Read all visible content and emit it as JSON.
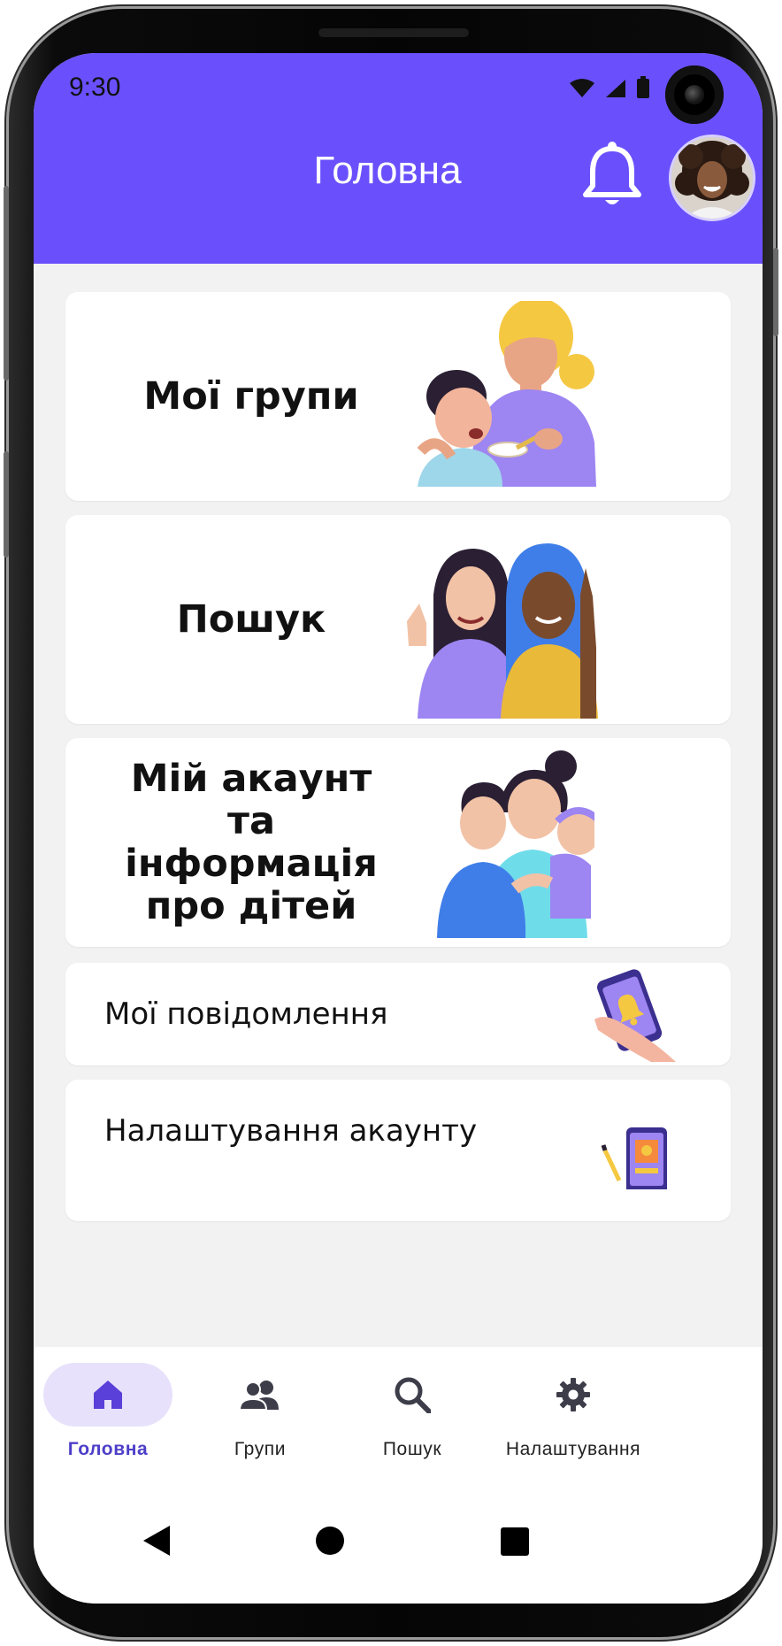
{
  "status_bar": {
    "time": "9:30"
  },
  "header": {
    "title": "Головна"
  },
  "colors": {
    "accent": "#6a50fc",
    "active_nav_bg": "#e8e1fb",
    "active_nav_text": "#4d3fc8"
  },
  "cards": [
    {
      "title": "Мої групи",
      "illustration": "mother-feeding-child-illustration"
    },
    {
      "title": "Пошук",
      "illustration": "two-women-thumbs-up-illustration"
    },
    {
      "title": "Мій акаунт та інформація про дітей",
      "illustration": "family-with-children-illustration"
    },
    {
      "title": "Мої повідомлення",
      "illustration": "phone-notification-illustration"
    },
    {
      "title": "Налаштування акаунту",
      "illustration": "phone-profile-illustration"
    }
  ],
  "bottom_nav": [
    {
      "label": "Головна",
      "icon": "home-icon",
      "active": true
    },
    {
      "label": "Групи",
      "icon": "group-icon",
      "active": false
    },
    {
      "label": "Пошук",
      "icon": "search-icon",
      "active": false
    },
    {
      "label": "Налаштування",
      "icon": "gear-icon",
      "active": false
    }
  ],
  "system_nav": [
    "back-icon",
    "home-circle-icon",
    "recents-icon"
  ]
}
